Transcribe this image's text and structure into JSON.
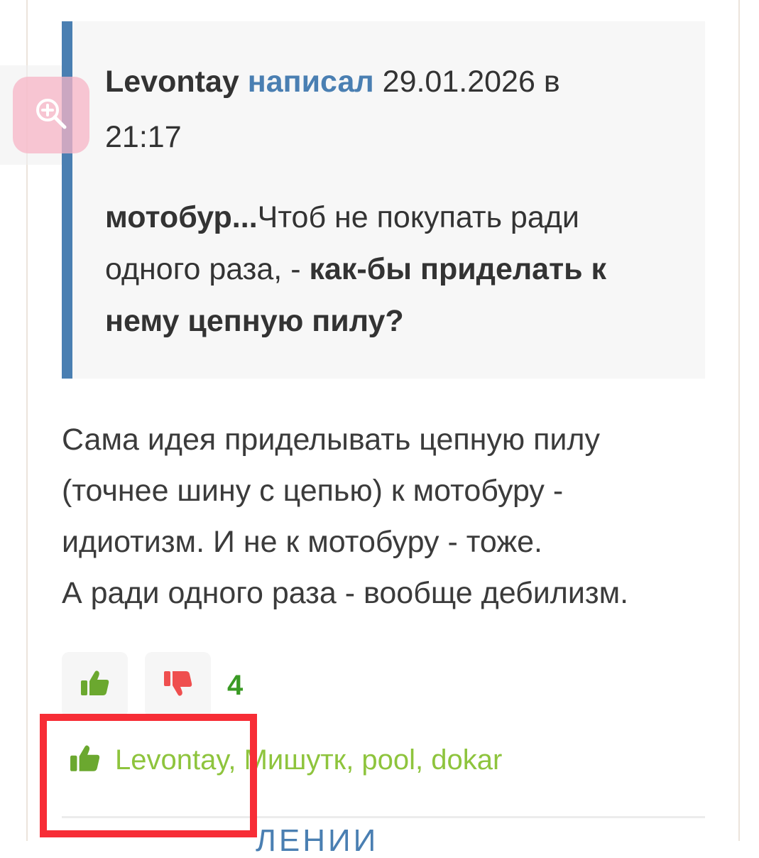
{
  "quote": {
    "author": "Levontay",
    "wrote_label": "написал",
    "datetime_line1": "29.01.2026 в",
    "datetime_line2": "21:17",
    "body_bold_lead": "мотобур...",
    "body_normal": "Чтоб не покупать ради одного раза, - ",
    "body_bold_tail": "как-бы приделать к нему цепную пилу?"
  },
  "post": {
    "line1": "Сама идея приделывать цепную пилу",
    "line2": "(точнее шину с цепью) к мотобуру -",
    "line3": "идиотизм. И не к мотобуру - тоже.",
    "line4": "А ради одного раза - вообще дебилизм."
  },
  "votes": {
    "count": "4"
  },
  "likes": {
    "users": [
      "Levontay",
      "Мишутк",
      "pool",
      "dokar"
    ],
    "separator": ", "
  },
  "cut_off_text": "ЛЕНИИ",
  "colors": {
    "quote_accent": "#4a7fb2",
    "like_green": "#6ba82f",
    "dislike_red": "#ef4f4f",
    "count_green": "#3a9a24",
    "likes_text": "#8ec43d",
    "highlight_red": "#f72d36",
    "zoom_button": "#f7b4c6"
  },
  "icons": {
    "zoom": "zoom-in-icon",
    "like": "thumbs-up-icon",
    "dislike": "thumbs-down-icon"
  }
}
